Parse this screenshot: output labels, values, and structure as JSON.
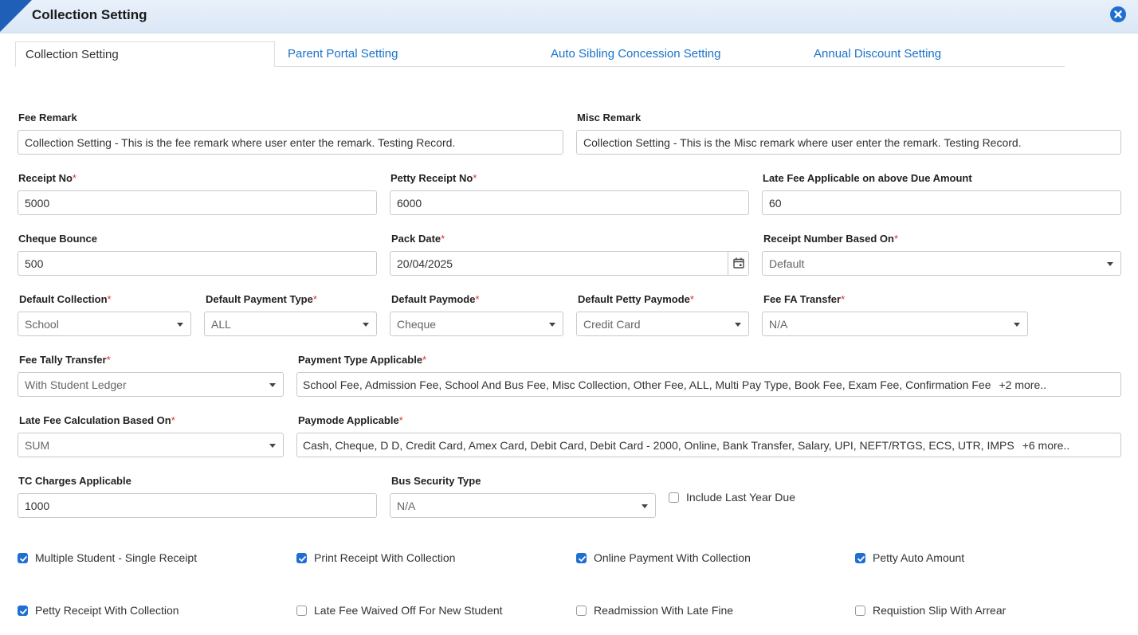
{
  "header": {
    "title": "Collection Setting"
  },
  "tabs": [
    {
      "label": "Collection Setting"
    },
    {
      "label": "Parent Portal Setting"
    },
    {
      "label": "Auto Sibling Concession Setting"
    },
    {
      "label": "Annual Discount Setting"
    }
  ],
  "fields": {
    "fee_remark": {
      "label": "Fee Remark",
      "value": "Collection Setting - This is the fee remark where user enter the remark. Testing Record."
    },
    "misc_remark": {
      "label": "Misc Remark",
      "value": "Collection Setting - This is the Misc remark where user enter the remark. Testing Record."
    },
    "receipt_no": {
      "label": "Receipt No",
      "value": "5000"
    },
    "petty_receipt_no": {
      "label": "Petty Receipt No",
      "value": "6000"
    },
    "late_fee_applicable": {
      "label": "Late Fee Applicable on above Due Amount",
      "value": "60"
    },
    "cheque_bounce": {
      "label": "Cheque Bounce",
      "value": "500"
    },
    "pack_date": {
      "label": "Pack Date",
      "value": "20/04/2025"
    },
    "receipt_number_based_on": {
      "label": "Receipt Number Based On",
      "value": "Default"
    },
    "default_collection": {
      "label": "Default Collection",
      "value": "School"
    },
    "default_payment_type": {
      "label": "Default Payment Type",
      "value": "ALL"
    },
    "default_paymode": {
      "label": "Default Paymode",
      "value": "Cheque"
    },
    "default_petty_paymode": {
      "label": "Default Petty Paymode",
      "value": "Credit Card"
    },
    "fee_fa_transfer": {
      "label": "Fee FA Transfer",
      "value": "N/A"
    },
    "fee_tally_transfer": {
      "label": "Fee Tally Transfer",
      "value": "With Student Ledger"
    },
    "payment_type_applicable": {
      "label": "Payment Type Applicable",
      "value": "School Fee, Admission Fee, School And Bus Fee, Misc Collection, Other Fee, ALL, Multi Pay Type, Book Fee, Exam Fee, Confirmation Fee",
      "more": "+2 more.."
    },
    "late_fee_calc": {
      "label": "Late Fee Calculation Based On",
      "value": "SUM"
    },
    "paymode_applicable": {
      "label": "Paymode Applicable",
      "value": "Cash, Cheque, D D, Credit Card, Amex Card, Debit Card, Debit Card - 2000, Online, Bank Transfer, Salary, UPI, NEFT/RTGS, ECS, UTR, IMPS",
      "more": "+6 more.."
    },
    "tc_charges": {
      "label": "TC Charges Applicable",
      "value": "1000"
    },
    "bus_security_type": {
      "label": "Bus Security Type",
      "value": "N/A"
    }
  },
  "required_mark": "*",
  "checkboxes": {
    "include_last_year_due": {
      "label": "Include Last Year Due",
      "checked": false
    },
    "multiple_student_single_receipt": {
      "label": "Multiple Student - Single Receipt",
      "checked": true
    },
    "print_receipt_with_collection": {
      "label": "Print Receipt With Collection",
      "checked": true
    },
    "online_payment_with_collection": {
      "label": "Online Payment With Collection",
      "checked": true
    },
    "petty_auto_amount": {
      "label": "Petty Auto Amount",
      "checked": true
    },
    "petty_receipt_with_collection": {
      "label": "Petty Receipt With Collection",
      "checked": true
    },
    "late_fee_waived_off": {
      "label": "Late Fee Waived Off For New Student",
      "checked": false
    },
    "readmission_with_late_fine": {
      "label": "Readmission With Late Fine",
      "checked": false
    },
    "requisition_slip_with_arrear": {
      "label": "Requistion Slip With Arrear",
      "checked": false
    }
  },
  "colors": {
    "accent": "#1f6fd1",
    "tab_link": "#1a73c8",
    "required": "#d9302b",
    "header_bg": "#dbe7f6"
  },
  "icons": {
    "close": "close-circle-icon",
    "calendar": "calendar-icon",
    "dropdown": "chevron-down-icon",
    "check": "check-icon"
  }
}
